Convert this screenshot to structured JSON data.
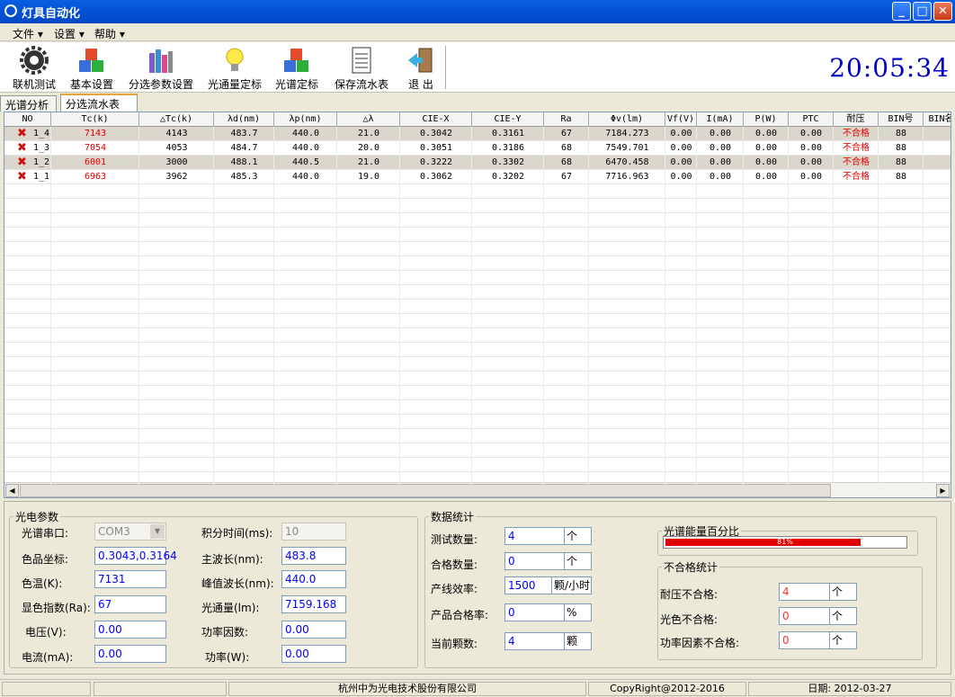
{
  "window": {
    "title": "灯具自动化"
  },
  "menu": [
    "文件 ▾",
    "设置 ▾",
    "帮助 ▾"
  ],
  "toolbar": [
    {
      "label": "联机测试",
      "icon": "gear-icon"
    },
    {
      "label": "基本设置",
      "icon": "cubes-icon"
    },
    {
      "label": "分选参数设置",
      "icon": "binders-icon"
    },
    {
      "label": "光通量定标",
      "icon": "lightbulb-icon"
    },
    {
      "label": "光谱定标",
      "icon": "cubes-icon"
    },
    {
      "label": "保存流水表",
      "icon": "document-icon"
    },
    {
      "label": "退 出",
      "icon": "exit-door-icon"
    }
  ],
  "clock": "20:05:34",
  "tabs": [
    "光谱分析",
    "分选流水表"
  ],
  "grid": {
    "columns": [
      "NO",
      "Tc(k)",
      "△Tc(k)",
      "λd(nm)",
      "λp(nm)",
      "△λ",
      "CIE-X",
      "CIE-Y",
      "Ra",
      "Φv(lm)",
      "Vf(V)",
      "I(mA)",
      "P(W)",
      "PTC",
      "耐压",
      "BIN号",
      "BIN名"
    ],
    "rows": [
      [
        "1_4",
        "7143",
        "4143",
        "483.7",
        "440.0",
        "21.0",
        "0.3042",
        "0.3161",
        "67",
        "7184.273",
        "0.00",
        "0.00",
        "0.00",
        "0.00",
        "不合格",
        "88",
        ""
      ],
      [
        "1_3",
        "7054",
        "4053",
        "484.7",
        "440.0",
        "20.0",
        "0.3051",
        "0.3186",
        "68",
        "7549.701",
        "0.00",
        "0.00",
        "0.00",
        "0.00",
        "不合格",
        "88",
        ""
      ],
      [
        "1_2",
        "6001",
        "3000",
        "488.1",
        "440.5",
        "21.0",
        "0.3222",
        "0.3302",
        "68",
        "6470.458",
        "0.00",
        "0.00",
        "0.00",
        "0.00",
        "不合格",
        "88",
        ""
      ],
      [
        "1_1",
        "6963",
        "3962",
        "485.3",
        "440.0",
        "19.0",
        "0.3062",
        "0.3202",
        "67",
        "7716.963",
        "0.00",
        "0.00",
        "0.00",
        "0.00",
        "不合格",
        "88",
        ""
      ]
    ]
  },
  "photo": {
    "title": "光电参数",
    "port_label": "光谱串口:",
    "port_value": "COM3",
    "integ_label": "积分时间(ms):",
    "integ_value": "10",
    "coord_label": "色品坐标:",
    "coord_value": "0.3043,0.3164",
    "dominant_label": "主波长(nm):",
    "dominant_value": "483.8",
    "cct_label": "色温(K):",
    "cct_value": "7131",
    "peak_label": "峰值波长(nm):",
    "peak_value": "440.0",
    "cri_label": "显色指数(Ra):",
    "cri_value": "67",
    "flux_label": "光通量(lm):",
    "flux_value": "7159.168",
    "volt_label": "电压(V):",
    "volt_value": "0.00",
    "pf_label": "功率因数:",
    "pf_value": "0.00",
    "curr_label": "电流(mA):",
    "curr_value": "0.00",
    "power_label": "功率(W):",
    "power_value": "0.00"
  },
  "stats": {
    "title": "数据统计",
    "test_label": "测试数量:",
    "test_value": "4",
    "test_unit": "个",
    "pass_label": "合格数量:",
    "pass_value": "0",
    "pass_unit": "个",
    "eff_label": "产线效率:",
    "eff_value": "1500",
    "eff_unit": "颗/小时",
    "rate_label": "产品合格率:",
    "rate_value": "0",
    "rate_unit": "%",
    "cur_label": "当前颗数:",
    "cur_value": "4",
    "cur_unit": "颗"
  },
  "energy": {
    "title": "光谱能量百分比",
    "value_text": "81%",
    "fraction": 0.81
  },
  "fail": {
    "title": "不合格统计",
    "hv_label": "耐压不合格:",
    "hv_value": "4",
    "hv_unit": "个",
    "color_label": "光色不合格:",
    "color_value": "0",
    "color_unit": "个",
    "pf_label": "功率因素不合格:",
    "pf_value": "0",
    "pf_unit": "个"
  },
  "status": {
    "company": "杭州中为光电技术股份有限公司",
    "copyright": "CopyRight@2012-2016",
    "date": "日期: 2012-03-27"
  }
}
